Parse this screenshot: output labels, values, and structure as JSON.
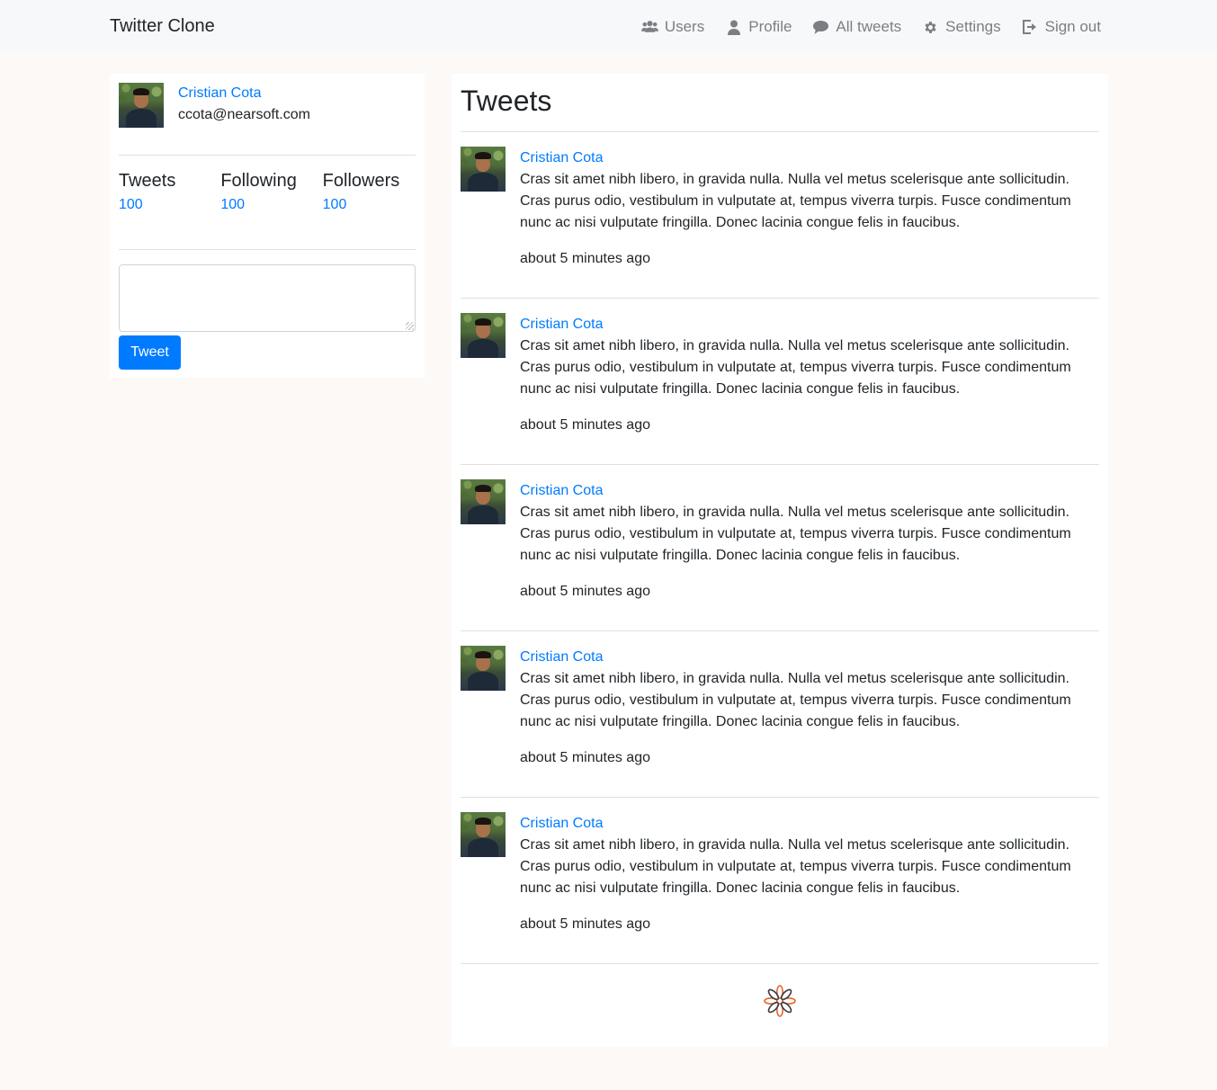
{
  "navbar": {
    "brand": "Twitter Clone",
    "items": [
      {
        "label": "Users",
        "icon": "users-icon"
      },
      {
        "label": "Profile",
        "icon": "user-icon"
      },
      {
        "label": "All tweets",
        "icon": "comment-icon"
      },
      {
        "label": "Settings",
        "icon": "gear-icon"
      },
      {
        "label": "Sign out",
        "icon": "sign-out-icon"
      }
    ]
  },
  "profile": {
    "name": "Cristian Cota",
    "email": "ccota@nearsoft.com",
    "stats": [
      {
        "label": "Tweets",
        "value": "100"
      },
      {
        "label": "Following",
        "value": "100"
      },
      {
        "label": "Followers",
        "value": "100"
      }
    ],
    "compose_placeholder": "",
    "tweet_button": "Tweet"
  },
  "feed": {
    "title": "Tweets",
    "tweets": [
      {
        "author": "Cristian Cota",
        "text": "Cras sit amet nibh libero, in gravida nulla. Nulla vel metus scelerisque ante sollicitudin. Cras purus odio, vestibulum in vulputate at, tempus viverra turpis. Fusce condimentum nunc ac nisi vulputate fringilla. Donec lacinia congue felis in faucibus.",
        "time": "about 5 minutes ago"
      },
      {
        "author": "Cristian Cota",
        "text": "Cras sit amet nibh libero, in gravida nulla. Nulla vel metus scelerisque ante sollicitudin. Cras purus odio, vestibulum in vulputate at, tempus viverra turpis. Fusce condimentum nunc ac nisi vulputate fringilla. Donec lacinia congue felis in faucibus.",
        "time": "about 5 minutes ago"
      },
      {
        "author": "Cristian Cota",
        "text": "Cras sit amet nibh libero, in gravida nulla. Nulla vel metus scelerisque ante sollicitudin. Cras purus odio, vestibulum in vulputate at, tempus viverra turpis. Fusce condimentum nunc ac nisi vulputate fringilla. Donec lacinia congue felis in faucibus.",
        "time": "about 5 minutes ago"
      },
      {
        "author": "Cristian Cota",
        "text": "Cras sit amet nibh libero, in gravida nulla. Nulla vel metus scelerisque ante sollicitudin. Cras purus odio, vestibulum in vulputate at, tempus viverra turpis. Fusce condimentum nunc ac nisi vulputate fringilla. Donec lacinia congue felis in faucibus.",
        "time": "about 5 minutes ago"
      },
      {
        "author": "Cristian Cota",
        "text": "Cras sit amet nibh libero, in gravida nulla. Nulla vel metus scelerisque ante sollicitudin. Cras purus odio, vestibulum in vulputate at, tempus viverra turpis. Fusce condimentum nunc ac nisi vulputate fringilla. Donec lacinia congue felis in faucibus.",
        "time": "about 5 minutes ago"
      }
    ],
    "loader_icon": "loading-spinner-icon"
  },
  "colors": {
    "link": "#007bff",
    "page_bg": "#fdf9f7",
    "navbar_bg": "#f7f8f9",
    "nav_text": "#7b7f83"
  }
}
